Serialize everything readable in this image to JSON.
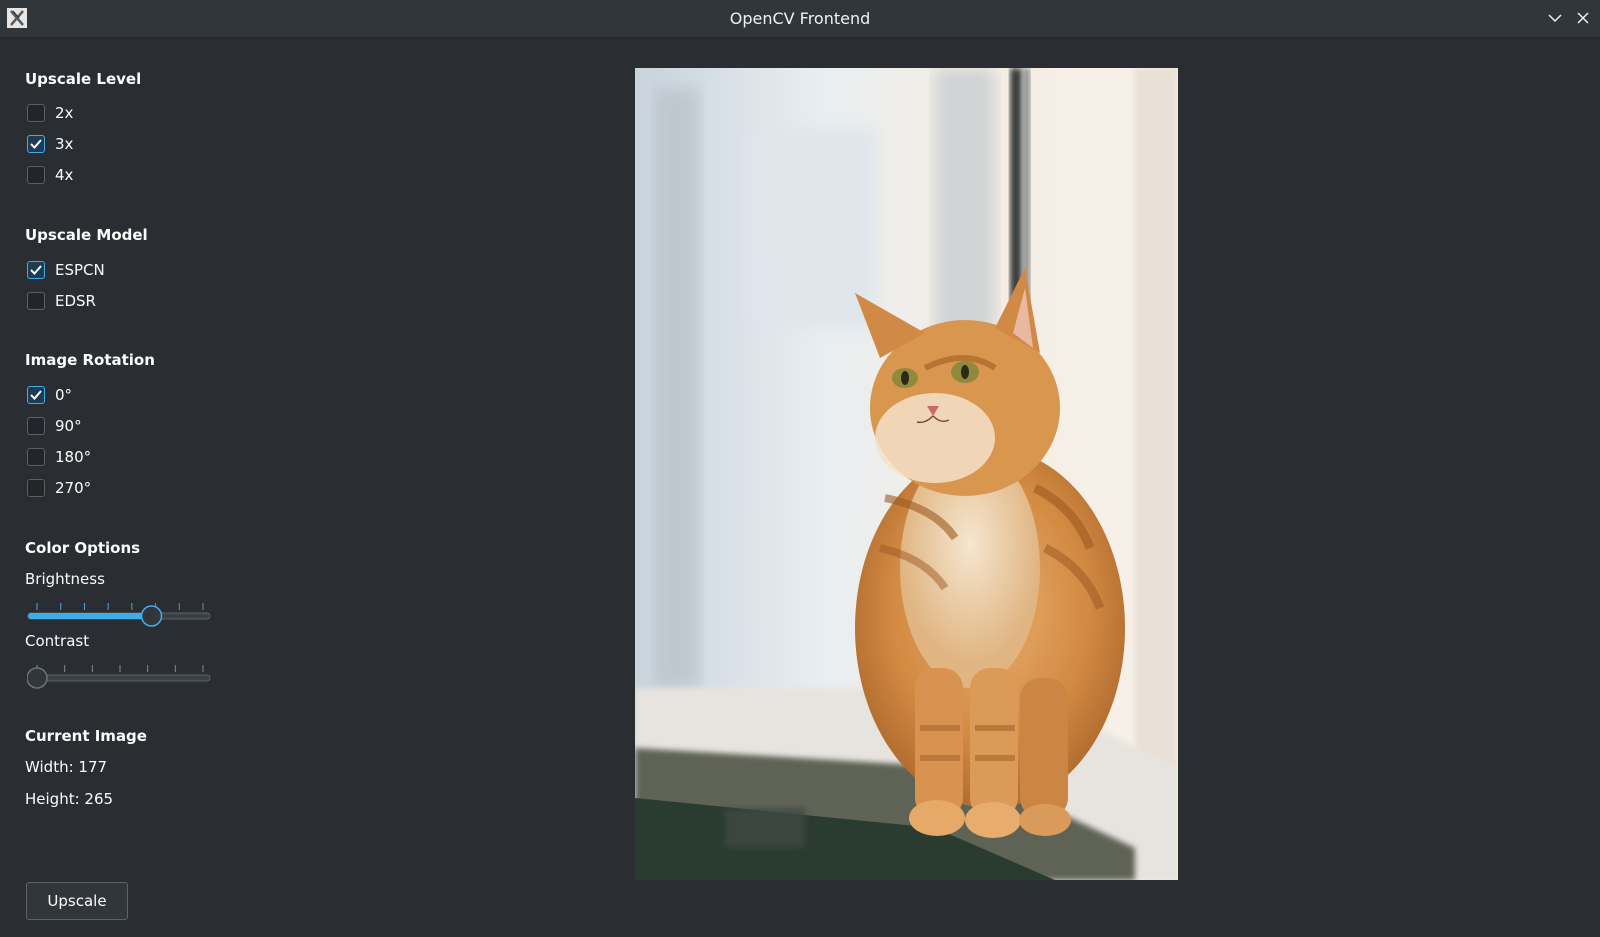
{
  "window": {
    "title": "OpenCV Frontend",
    "icons": {
      "app": "x-app-icon",
      "minimize": "chevron-down-icon",
      "close": "close-icon"
    }
  },
  "upscale_level": {
    "title": "Upscale Level",
    "options": [
      {
        "label": "2x",
        "checked": false
      },
      {
        "label": "3x",
        "checked": true
      },
      {
        "label": "4x",
        "checked": false
      }
    ]
  },
  "upscale_model": {
    "title": "Upscale Model",
    "options": [
      {
        "label": "ESPCN",
        "checked": true
      },
      {
        "label": "EDSR",
        "checked": false
      }
    ]
  },
  "image_rotation": {
    "title": "Image Rotation",
    "options": [
      {
        "label": "0°",
        "checked": true
      },
      {
        "label": "90°",
        "checked": false
      },
      {
        "label": "180°",
        "checked": false
      },
      {
        "label": "270°",
        "checked": false
      }
    ]
  },
  "color_options": {
    "title": "Color Options",
    "brightness": {
      "label": "Brightness",
      "value_fraction": 0.69,
      "ticks": 8
    },
    "contrast": {
      "label": "Contrast",
      "value_fraction": 0.0,
      "ticks": 7
    }
  },
  "current_image": {
    "title": "Current Image",
    "width_text": "Width: 177",
    "height_text": "Height: 265"
  },
  "actions": {
    "upscale_label": "Upscale"
  },
  "colors": {
    "background": "#2a2e32",
    "titlebar": "#31363b",
    "accent": "#3daee9",
    "text": "#fcfcfc"
  }
}
